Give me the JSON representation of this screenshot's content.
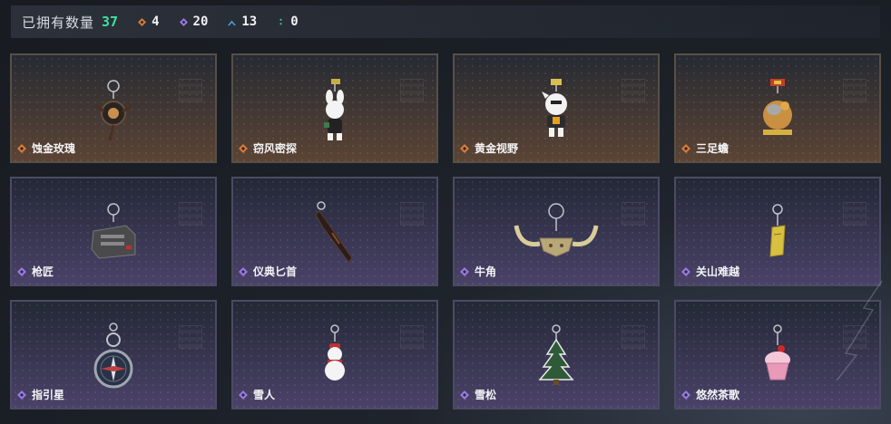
{
  "header": {
    "title": "已拥有数量",
    "total": "37",
    "stats": [
      {
        "icon": "orange-rarity-icon",
        "color": "#d77a3a",
        "value": "4"
      },
      {
        "icon": "purple-rarity-icon",
        "color": "#9a78e0",
        "value": "20"
      },
      {
        "icon": "blue-rarity-icon",
        "color": "#4aa8e8",
        "value": "13"
      },
      {
        "icon": "green-rarity-icon",
        "color": "#3ee0a0",
        "value": "0"
      }
    ]
  },
  "charms": [
    {
      "name": "蚀金玫瑰",
      "rarity": "orange",
      "icon": "rose-charm-icon"
    },
    {
      "name": "窃风密探",
      "rarity": "orange",
      "icon": "bunny-charm-icon"
    },
    {
      "name": "黄金视野",
      "rarity": "orange",
      "icon": "chibi-charm-icon"
    },
    {
      "name": "三足蟾",
      "rarity": "orange",
      "icon": "toad-charm-icon"
    },
    {
      "name": "枪匠",
      "rarity": "purple",
      "icon": "toolbox-charm-icon"
    },
    {
      "name": "仪典匕首",
      "rarity": "purple",
      "icon": "dagger-charm-icon"
    },
    {
      "name": "牛角",
      "rarity": "purple",
      "icon": "horns-charm-icon"
    },
    {
      "name": "关山难越",
      "rarity": "purple",
      "icon": "bar-charm-icon"
    },
    {
      "name": "指引星",
      "rarity": "purple",
      "icon": "compass-charm-icon"
    },
    {
      "name": "雪人",
      "rarity": "purple",
      "icon": "snowman-charm-icon"
    },
    {
      "name": "雪松",
      "rarity": "purple",
      "icon": "tree-charm-icon"
    },
    {
      "name": "悠然茶歌",
      "rarity": "purple",
      "icon": "cupcake-charm-icon"
    }
  ]
}
